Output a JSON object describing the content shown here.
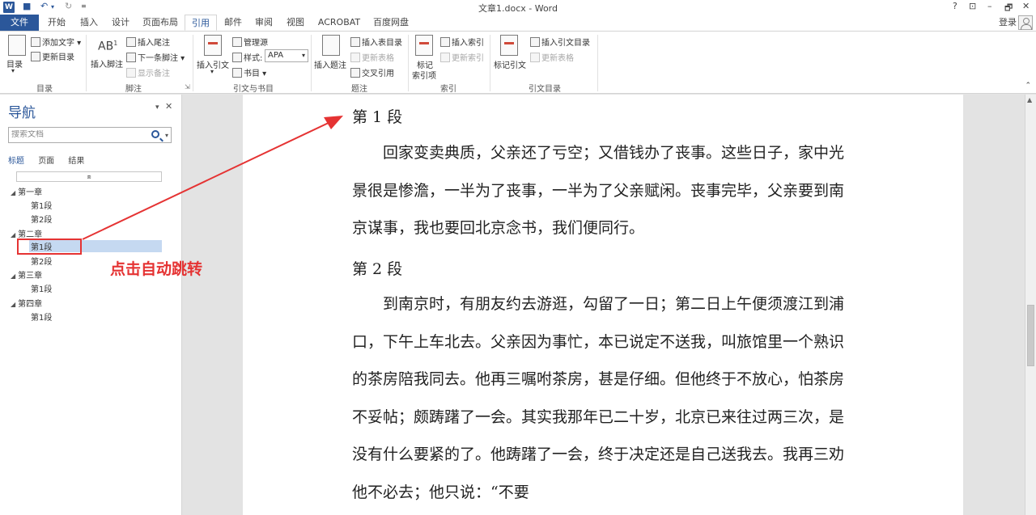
{
  "titlebar": {
    "app_logo": "W",
    "title": "文章1.docx - Word",
    "window_controls": [
      "?",
      "⊡",
      "–",
      "🗗",
      "✕"
    ]
  },
  "tabs": [
    {
      "label": "文件"
    },
    {
      "label": "开始"
    },
    {
      "label": "插入"
    },
    {
      "label": "设计"
    },
    {
      "label": "页面布局"
    },
    {
      "label": "引用"
    },
    {
      "label": "邮件"
    },
    {
      "label": "审阅"
    },
    {
      "label": "视图"
    },
    {
      "label": "ACROBAT"
    },
    {
      "label": "百度网盘"
    }
  ],
  "active_tab": "引用",
  "account": {
    "login_label": "登录"
  },
  "ribbon": {
    "toc": {
      "label": "目录",
      "add_text": "添加文字",
      "update_toc": "更新目录",
      "group": "目录"
    },
    "footnotes": {
      "insert_footnote": "插入脚注",
      "insert_endnote": "插入尾注",
      "next_footnote": "下一条脚注",
      "show_notes": "显示备注",
      "group": "脚注"
    },
    "citations": {
      "insert_citation": "插入引文",
      "manage_sources": "管理源",
      "style_label": "样式:",
      "style_value": "APA",
      "bibliography": "书目",
      "group": "引文与书目"
    },
    "captions": {
      "insert_caption": "插入题注",
      "insert_table_of_figures": "插入表目录",
      "update_table": "更新表格",
      "cross_reference": "交叉引用",
      "group": "题注"
    },
    "index": {
      "mark_entry_l1": "标记",
      "mark_entry_l2": "索引项",
      "insert_index": "插入索引",
      "update_index": "更新索引",
      "group": "索引"
    },
    "toa": {
      "mark_citation": "标记引文",
      "insert_toa": "插入引文目录",
      "update_table": "更新表格",
      "group": "引文目录"
    }
  },
  "nav_pane": {
    "title": "导航",
    "search_placeholder": "搜索文档",
    "tabs": [
      {
        "label": "标题"
      },
      {
        "label": "页面"
      },
      {
        "label": "结果"
      }
    ],
    "active_tab": "标题",
    "tree": [
      {
        "label": "第一章",
        "level": 1
      },
      {
        "label": "第1段",
        "level": 2
      },
      {
        "label": "第2段",
        "level": 2
      },
      {
        "label": "第二章",
        "level": 1
      },
      {
        "label": "第1段",
        "level": 2,
        "selected": true
      },
      {
        "label": "第2段",
        "level": 2
      },
      {
        "label": "第三章",
        "level": 1
      },
      {
        "label": "第1段",
        "level": 2
      },
      {
        "label": "第四章",
        "level": 1
      },
      {
        "label": "第1段",
        "level": 2
      }
    ]
  },
  "document": {
    "heading1": "第 1 段",
    "para1": "回家变卖典质，父亲还了亏空；又借钱办了丧事。这些日子，家中光景很是惨澹，一半为了丧事，一半为了父亲赋闲。丧事完毕，父亲要到南京谋事，我也要回北京念书，我们便同行。",
    "heading2": "第 2 段",
    "para2": "到南京时，有朋友约去游逛，勾留了一日；第二日上午便须渡江到浦口，下午上车北去。父亲因为事忙，本已说定不送我，叫旅馆里一个熟识的茶房陪我同去。他再三嘱咐茶房，甚是仔细。但他终于不放心，怕茶房不妥帖；颇踌躇了一会。其实我那年已二十岁，北京已来往过两三次，是没有什么要紧的了。他踌躇了一会，终于决定还是自己送我去。我再三劝他不必去；他只说：“不要"
  },
  "annotation": {
    "text": "点击自动跳转",
    "color": "#e53333"
  },
  "colors": {
    "accent": "#2b579a",
    "selection": "#c5d9f1"
  }
}
